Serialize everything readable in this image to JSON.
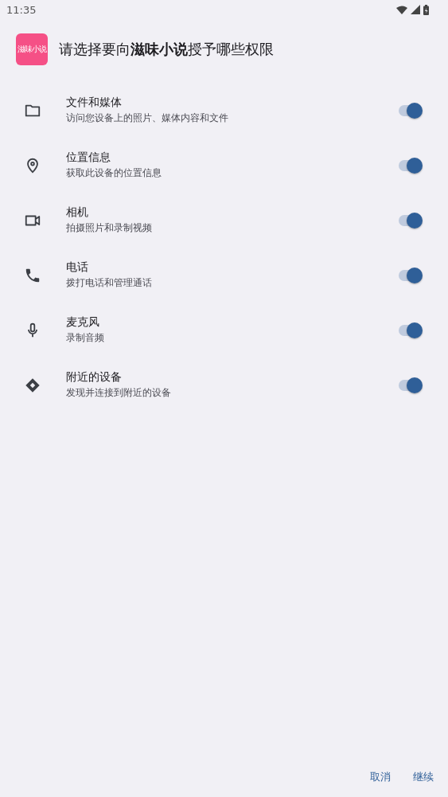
{
  "status_bar": {
    "time": "11:35"
  },
  "header": {
    "app_logo_text": "滋味小说",
    "title": "请选择要向**滋味小说**授予哪些权限"
  },
  "permissions": [
    {
      "kind": "folder",
      "name": "文件和媒体",
      "description": "访问您设备上的照片、媒体内容和文件",
      "on": true
    },
    {
      "kind": "location",
      "name": "位置信息",
      "description": "获取此设备的位置信息",
      "on": true
    },
    {
      "kind": "camera",
      "name": "相机",
      "description": "拍摄照片和录制视频",
      "on": true
    },
    {
      "kind": "phone",
      "name": "电话",
      "description": "拨打电话和管理通话",
      "on": true
    },
    {
      "kind": "microphone",
      "name": "麦克风",
      "description": "录制音频",
      "on": true
    },
    {
      "kind": "nearby",
      "name": "附近的设备",
      "description": "发现并连接到附近的设备",
      "on": true
    }
  ],
  "buttons": [
    "取消",
    "继续"
  ]
}
